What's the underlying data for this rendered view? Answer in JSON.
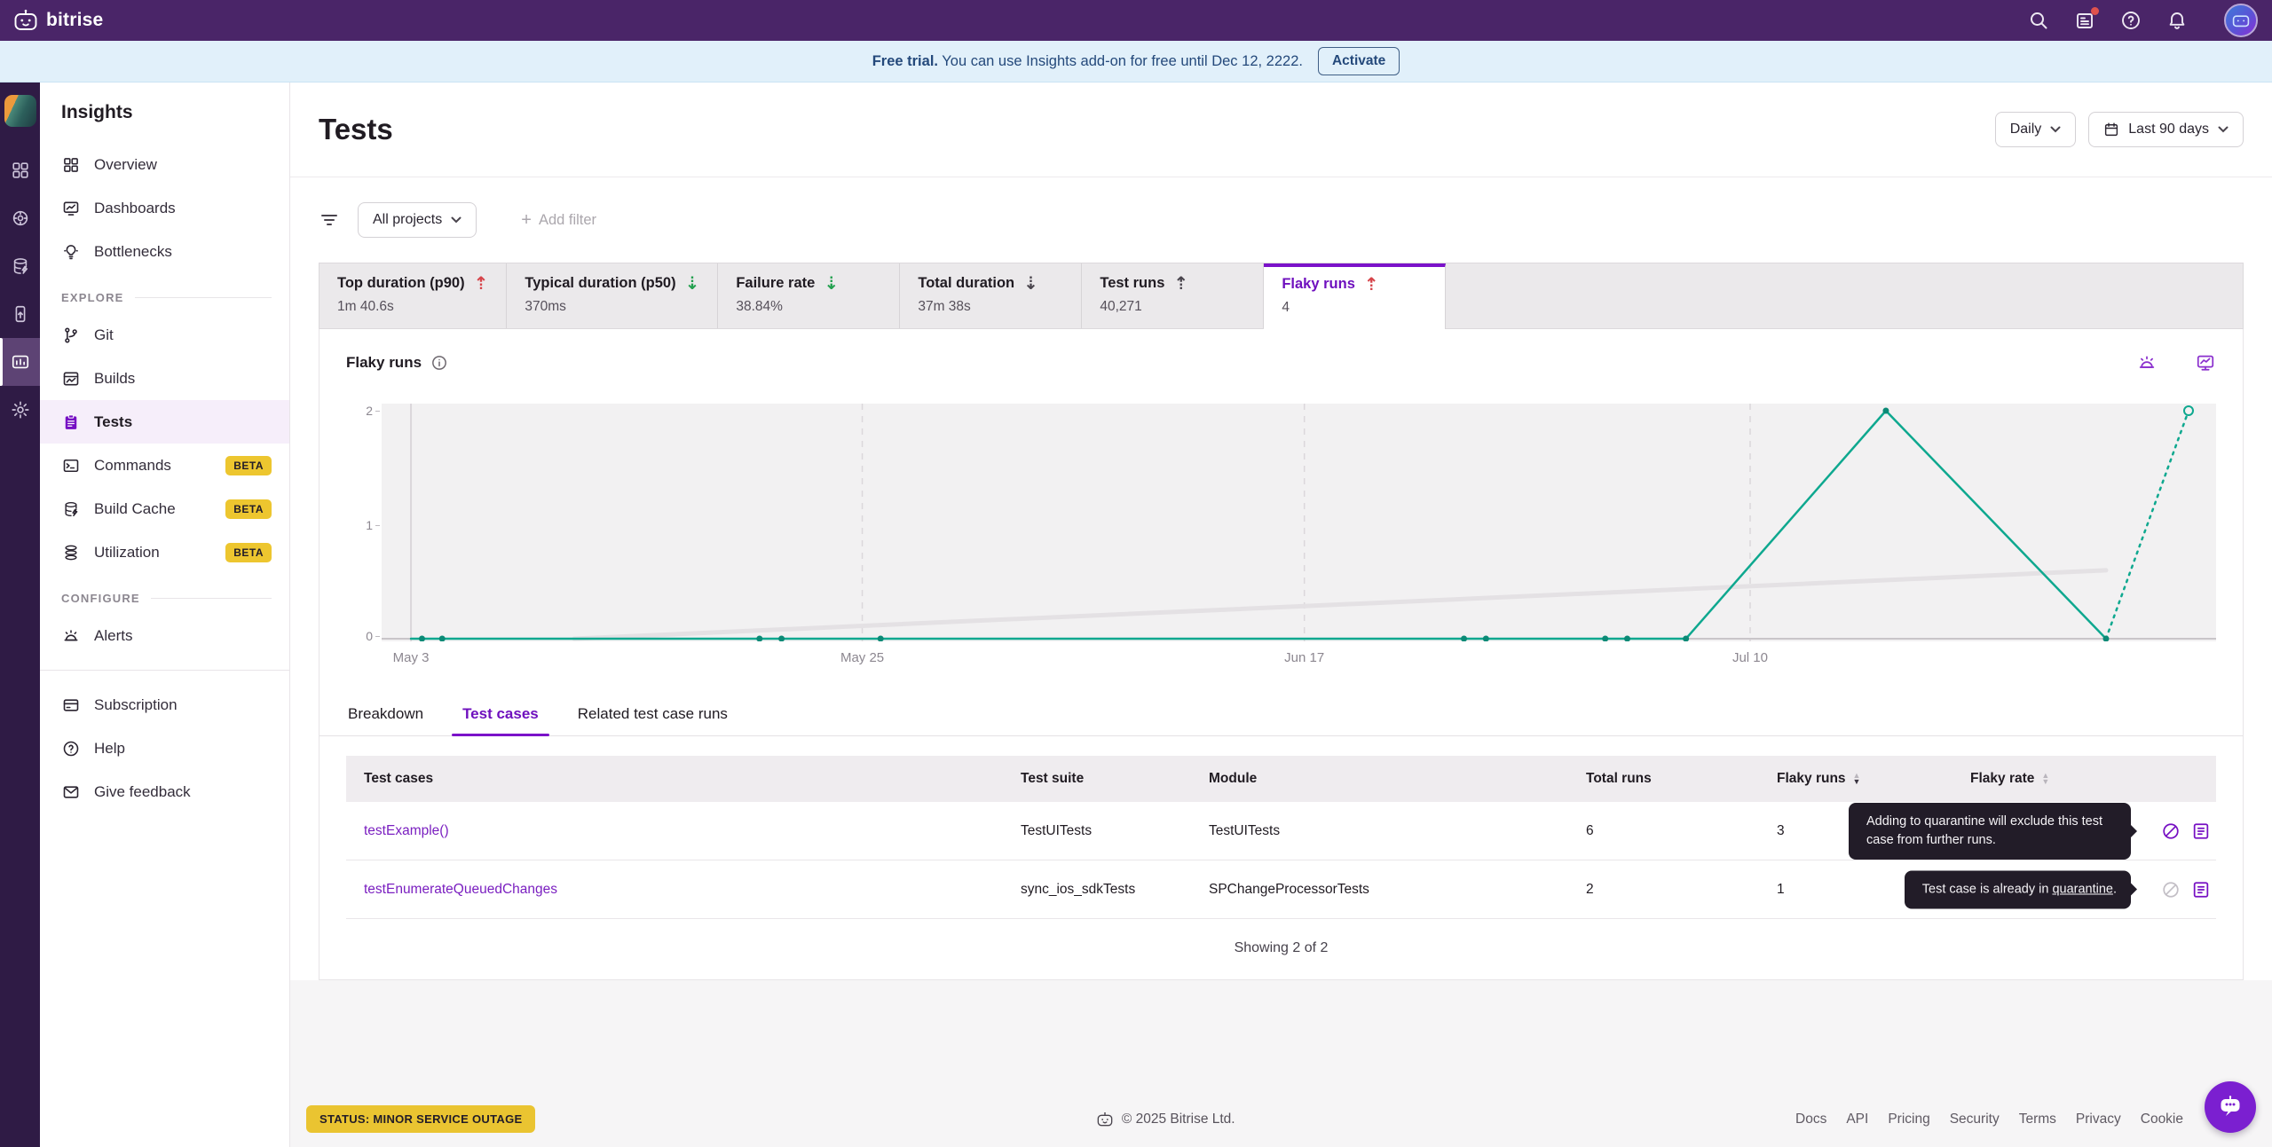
{
  "topbar": {
    "brand": "bitrise"
  },
  "banner": {
    "bold": "Free trial.",
    "text": "You can use Insights add-on for free until Dec 12, 2222.",
    "activate": "Activate"
  },
  "sidebar": {
    "title": "Insights",
    "beta": "BETA",
    "sections": {
      "explore": "EXPLORE",
      "configure": "CONFIGURE"
    },
    "items": [
      {
        "label": "Overview"
      },
      {
        "label": "Dashboards"
      },
      {
        "label": "Bottlenecks"
      },
      {
        "label": "Git"
      },
      {
        "label": "Builds"
      },
      {
        "label": "Tests"
      },
      {
        "label": "Commands"
      },
      {
        "label": "Build Cache"
      },
      {
        "label": "Utilization"
      },
      {
        "label": "Alerts"
      },
      {
        "label": "Subscription"
      },
      {
        "label": "Help"
      },
      {
        "label": "Give feedback"
      }
    ]
  },
  "header": {
    "title": "Tests",
    "granularity": "Daily",
    "range": "Last 90 days"
  },
  "filters": {
    "projects": "All projects",
    "add": "Add filter",
    "plus": "+"
  },
  "metrics": [
    {
      "label": "Top duration (p90)",
      "value": "1m 40.6s",
      "direction": "up",
      "tone": "bad"
    },
    {
      "label": "Typical duration (p50)",
      "value": "370ms",
      "direction": "down",
      "tone": "good"
    },
    {
      "label": "Failure rate",
      "value": "38.84%",
      "direction": "down",
      "tone": "good"
    },
    {
      "label": "Total duration",
      "value": "37m 38s",
      "direction": "down",
      "tone": "neutral"
    },
    {
      "label": "Test runs",
      "value": "40,271",
      "direction": "up",
      "tone": "neutral"
    },
    {
      "label": "Flaky runs",
      "value": "4",
      "direction": "up",
      "tone": "bad"
    }
  ],
  "chart_data": {
    "type": "line",
    "title": "Flaky runs",
    "xlabel": "",
    "ylabel": "",
    "ylim": [
      0,
      2
    ],
    "yticks": [
      0,
      1,
      2
    ],
    "grid": "vertical-dashed",
    "legend": "none",
    "xticks": [
      {
        "label": "May 3",
        "pos": 1.6,
        "line": "solid"
      },
      {
        "label": "May 25",
        "pos": 26.2,
        "line": "dashed"
      },
      {
        "label": "Jun 17",
        "pos": 50.3,
        "line": "dashed"
      },
      {
        "label": "Jul 10",
        "pos": 74.6,
        "line": "dashed"
      }
    ],
    "series": [
      {
        "name": "Trend",
        "color": "#E4E1E4",
        "style": "solid",
        "width": 5,
        "points": [
          [
            10.5,
            0
          ],
          [
            94,
            0.6
          ]
        ]
      },
      {
        "name": "Flaky runs",
        "color": "#0EA88F",
        "style": "solid",
        "width": 2.5,
        "points": [
          [
            1.6,
            0
          ],
          [
            71.1,
            0
          ],
          [
            82,
            2
          ],
          [
            94,
            0
          ]
        ]
      },
      {
        "name": "Flaky runs (incomplete period)",
        "color": "#0EA88F",
        "style": "dotted",
        "width": 2.5,
        "points": [
          [
            94,
            0
          ],
          [
            98.5,
            2
          ]
        ],
        "end_marker": "open"
      }
    ],
    "markers": {
      "color": "#0B8A76",
      "points": [
        [
          2.2,
          0
        ],
        [
          3.3,
          0
        ],
        [
          20.6,
          0
        ],
        [
          21.8,
          0
        ],
        [
          27.2,
          0
        ],
        [
          59,
          0
        ],
        [
          60.2,
          0
        ],
        [
          66.7,
          0
        ],
        [
          67.9,
          0
        ],
        [
          71.1,
          0
        ],
        [
          82,
          2
        ],
        [
          94,
          0
        ]
      ]
    }
  },
  "subtabs": [
    {
      "label": "Breakdown"
    },
    {
      "label": "Test cases"
    },
    {
      "label": "Related test case runs"
    }
  ],
  "table": {
    "columns": [
      "Test cases",
      "Test suite",
      "Module",
      "Total runs",
      "Flaky runs",
      "Flaky rate"
    ],
    "rows": [
      {
        "name": "testExample()",
        "suite": "TestUITests",
        "module": "TestUITests",
        "total": "6",
        "flaky": "3"
      },
      {
        "name": "testEnumerateQueuedChanges",
        "suite": "sync_ios_sdkTests",
        "module": "SPChangeProcessorTests",
        "total": "2",
        "flaky": "1"
      }
    ],
    "showing": "Showing 2 of 2",
    "tooltips": {
      "quarantine_add": "Adding to quarantine will exclude this test case  from further runs.",
      "quarantine_already_pre": "Test case is already in ",
      "quarantine_already_link": "quarantine",
      "quarantine_already_post": "."
    }
  },
  "footer": {
    "status": "STATUS: MINOR SERVICE OUTAGE",
    "copyright": "© 2025 Bitrise Ltd.",
    "links": [
      {
        "label": "Docs"
      },
      {
        "label": "API"
      },
      {
        "label": "Pricing"
      },
      {
        "label": "Security"
      },
      {
        "label": "Terms"
      },
      {
        "label": "Privacy"
      },
      {
        "label": "Cookie"
      }
    ]
  },
  "colors": {
    "topbar_purple": "#4A2568",
    "rail_purple": "#2F1B45",
    "brand_purple": "#760FC3",
    "teal": "#0EA88F",
    "banner_blue": "#24497B",
    "beta_yellow": "#EDC62F",
    "status_yellow": "#EAC431",
    "tooltip_bg": "#221C28",
    "bad_red": "#D6444A",
    "good_green": "#23A04F"
  }
}
